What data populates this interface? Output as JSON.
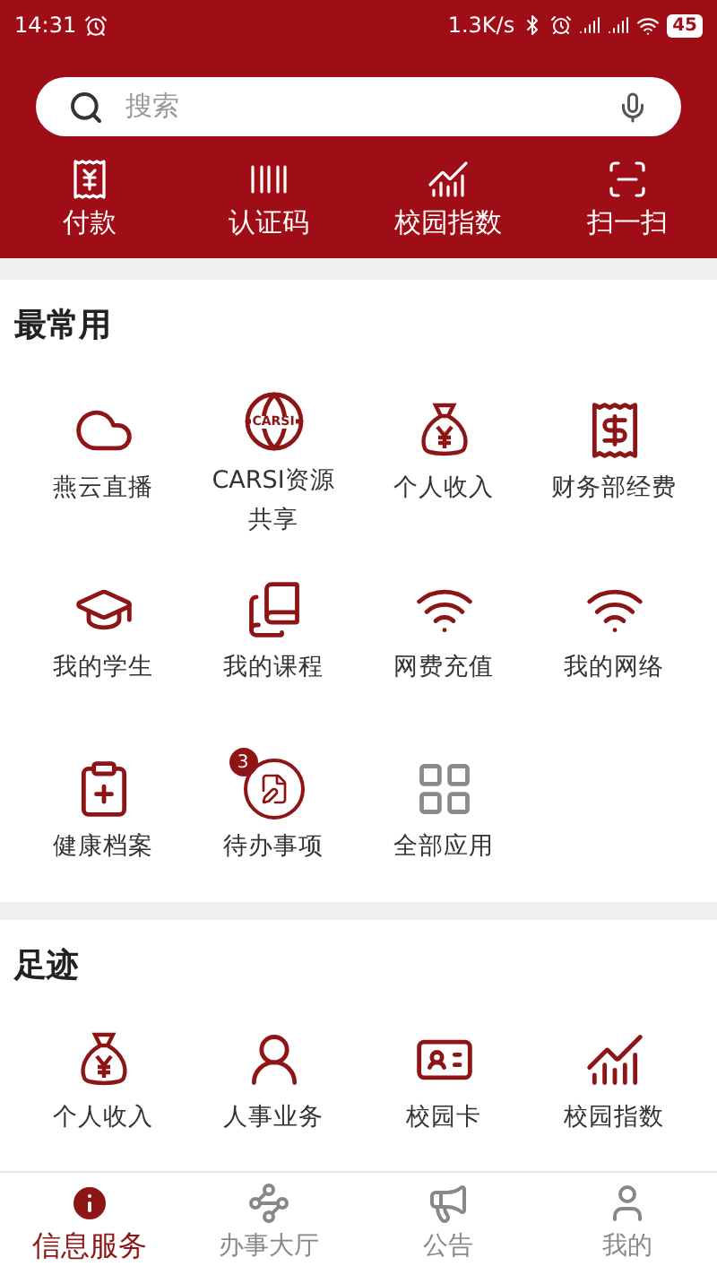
{
  "status_bar": {
    "time": "14:31",
    "speed": "1.3K/s",
    "battery": "45"
  },
  "search": {
    "placeholder": "搜索"
  },
  "quick_actions": [
    {
      "label": "付款"
    },
    {
      "label": "认证码"
    },
    {
      "label": "校园指数"
    },
    {
      "label": "扫一扫"
    }
  ],
  "frequent": {
    "title": "最常用",
    "items": [
      {
        "label": "燕云直播"
      },
      {
        "label": "CARSI资源共享",
        "icon_text": "CARSI"
      },
      {
        "label": "个人收入"
      },
      {
        "label": "财务部经费"
      },
      {
        "label": "我的学生"
      },
      {
        "label": "我的课程"
      },
      {
        "label": "网费充值"
      },
      {
        "label": "我的网络"
      },
      {
        "label": "健康档案"
      },
      {
        "label": "待办事项",
        "badge": "3"
      },
      {
        "label": "全部应用"
      }
    ]
  },
  "footprints": {
    "title": "足迹",
    "items": [
      {
        "label": "个人收入"
      },
      {
        "label": "人事业务"
      },
      {
        "label": "校园卡"
      },
      {
        "label": "校园指数"
      }
    ]
  },
  "bottom_nav": [
    {
      "label": "信息服务",
      "selected": true
    },
    {
      "label": "办事大厅",
      "selected": false
    },
    {
      "label": "公告",
      "selected": false
    },
    {
      "label": "我的",
      "selected": false
    }
  ]
}
